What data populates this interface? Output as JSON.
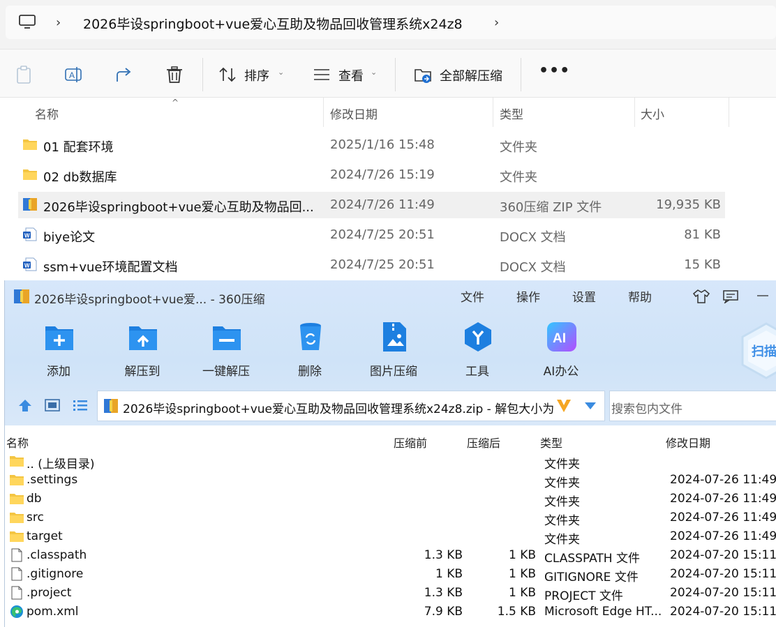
{
  "explorer": {
    "path": "2026毕设springboot+vue爱心互助及物品回收管理系统x24z8",
    "toolbar": {
      "sort": "排序",
      "view": "查看",
      "extract_all": "全部解压缩"
    },
    "columns": {
      "name": "名称",
      "date": "修改日期",
      "type": "类型",
      "size": "大小"
    },
    "rows": [
      {
        "name": "01 配套环境",
        "date": "2025/1/16 15:48",
        "type": "文件夹",
        "size": "",
        "icon": "folder-icon"
      },
      {
        "name": "02 db数据库",
        "date": "2024/7/26 15:19",
        "type": "文件夹",
        "size": "",
        "icon": "folder-icon"
      },
      {
        "name": "2026毕设springboot+vue爱心互助及物品回...",
        "date": "2024/7/26 11:49",
        "type": "360压缩 ZIP 文件",
        "size": "19,935 KB",
        "icon": "zip-archive-icon"
      },
      {
        "name": "biye论文",
        "date": "2024/7/25 20:51",
        "type": "DOCX 文档",
        "size": "81 KB",
        "icon": "word-doc-icon"
      },
      {
        "name": "ssm+vue环境配置文档",
        "date": "2024/7/25 20:51",
        "type": "DOCX 文档",
        "size": "15 KB",
        "icon": "word-doc-icon"
      }
    ]
  },
  "zip": {
    "title": "2026毕设springboot+vue爱... - 360压缩",
    "menu": [
      "文件",
      "操作",
      "设置",
      "帮助"
    ],
    "toolbar": [
      "添加",
      "解压到",
      "一键解压",
      "删除",
      "图片压缩",
      "工具",
      "AI办公"
    ],
    "ai_badge": "AI",
    "scan_label": "扫描",
    "address": "2026毕设springboot+vue爱心互助及物品回收管理系统x24z8.zip - 解包大小为 3",
    "search_placeholder": "搜索包内文件",
    "columns": {
      "name": "名称",
      "packed": "压缩前",
      "compressed": "压缩后",
      "type": "类型",
      "modified": "修改日期"
    },
    "rows": [
      {
        "name": ".. (上级目录)",
        "packed": "",
        "compressed": "",
        "type": "文件夹",
        "modified": "",
        "icon": "folder-icon"
      },
      {
        "name": ".settings",
        "packed": "",
        "compressed": "",
        "type": "文件夹",
        "modified": "2024-07-26 11:49",
        "icon": "folder-icon"
      },
      {
        "name": "db",
        "packed": "",
        "compressed": "",
        "type": "文件夹",
        "modified": "2024-07-26 11:49",
        "icon": "folder-icon"
      },
      {
        "name": "src",
        "packed": "",
        "compressed": "",
        "type": "文件夹",
        "modified": "2024-07-26 11:49",
        "icon": "folder-icon"
      },
      {
        "name": "target",
        "packed": "",
        "compressed": "",
        "type": "文件夹",
        "modified": "2024-07-26 11:49",
        "icon": "folder-icon"
      },
      {
        "name": ".classpath",
        "packed": "1.3 KB",
        "compressed": "1 KB",
        "type": "CLASSPATH 文件",
        "modified": "2024-07-20 15:11",
        "icon": "file-icon"
      },
      {
        "name": ".gitignore",
        "packed": "1 KB",
        "compressed": "1 KB",
        "type": "GITIGNORE 文件",
        "modified": "2024-07-20 15:11",
        "icon": "file-icon"
      },
      {
        "name": ".project",
        "packed": "1.3 KB",
        "compressed": "1 KB",
        "type": "PROJECT 文件",
        "modified": "2024-07-20 15:11",
        "icon": "file-icon"
      },
      {
        "name": "pom.xml",
        "packed": "7.9 KB",
        "compressed": "1.5 KB",
        "type": "Microsoft Edge HT...",
        "modified": "2024-07-20 15:11",
        "icon": "edge-icon"
      }
    ]
  }
}
